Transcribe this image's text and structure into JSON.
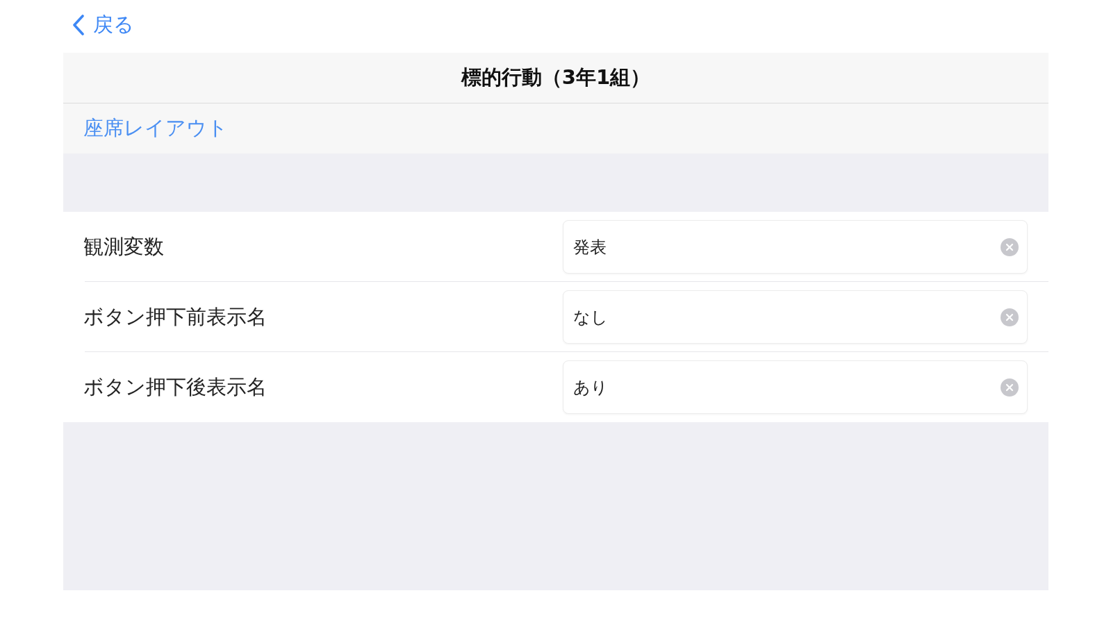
{
  "back_button": {
    "label": "戻る"
  },
  "header": {
    "title": "標的行動（3年1組）"
  },
  "link": {
    "label": "座席レイアウト"
  },
  "fields": [
    {
      "label": "観測変数",
      "value": "発表"
    },
    {
      "label": "ボタン押下前表示名",
      "value": "なし"
    },
    {
      "label": "ボタン押下後表示名",
      "value": "あり"
    }
  ]
}
